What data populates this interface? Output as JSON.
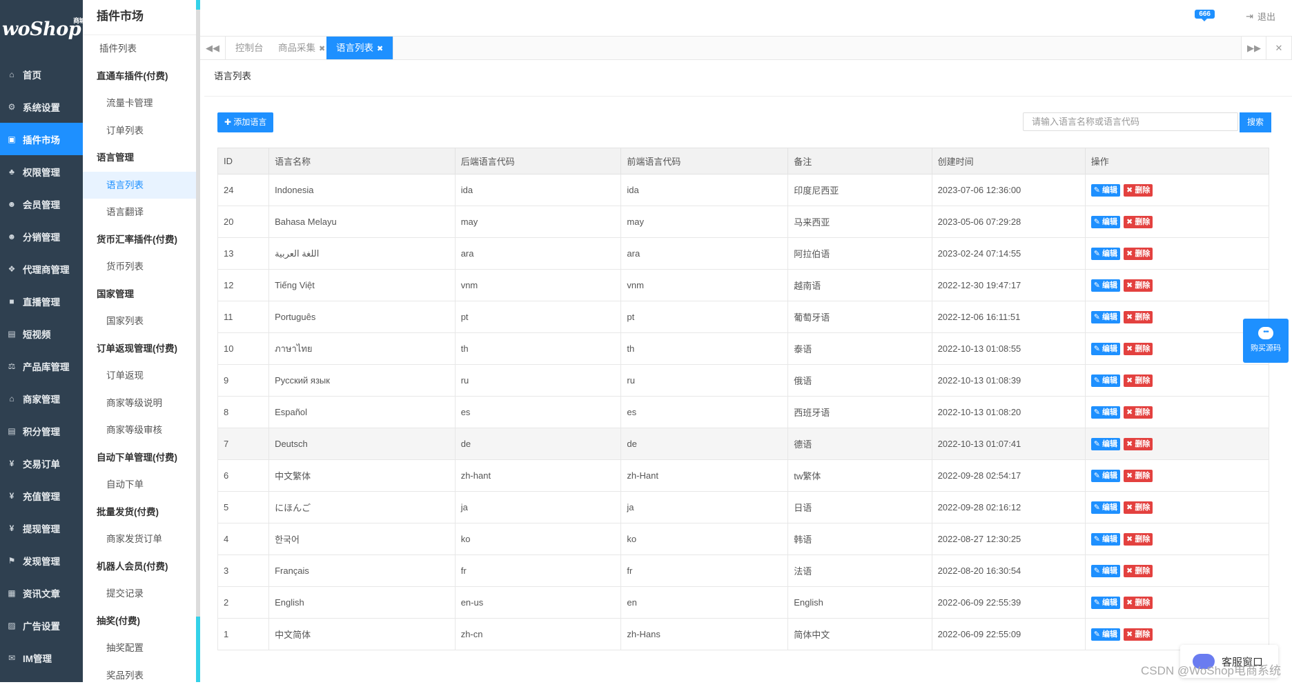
{
  "brand": {
    "logo_text": "woShop",
    "logo_sup": "商城"
  },
  "nav": [
    {
      "label": "首页",
      "icon": "home-icon",
      "glyph": "⌂"
    },
    {
      "label": "系统设置",
      "icon": "gear-icon",
      "glyph": "⚙"
    },
    {
      "label": "插件市场",
      "icon": "plugin-icon",
      "glyph": "▣",
      "active": true
    },
    {
      "label": "权限管理",
      "icon": "sitemap-icon",
      "glyph": "♣"
    },
    {
      "label": "会员管理",
      "icon": "users-icon",
      "glyph": "☻"
    },
    {
      "label": "分销管理",
      "icon": "group-icon",
      "glyph": "☻"
    },
    {
      "label": "代理商管理",
      "icon": "cubes-icon",
      "glyph": "❖"
    },
    {
      "label": "直播管理",
      "icon": "video-icon",
      "glyph": "■"
    },
    {
      "label": "短视频",
      "icon": "file-icon",
      "glyph": "▤"
    },
    {
      "label": "产品库管理",
      "icon": "balance-icon",
      "glyph": "⚖"
    },
    {
      "label": "商家管理",
      "icon": "bank-icon",
      "glyph": "⌂"
    },
    {
      "label": "积分管理",
      "icon": "document-icon",
      "glyph": "▤"
    },
    {
      "label": "交易订单",
      "icon": "yen-icon",
      "glyph": "¥"
    },
    {
      "label": "充值管理",
      "icon": "yen-icon",
      "glyph": "¥"
    },
    {
      "label": "提现管理",
      "icon": "yen-icon",
      "glyph": "¥"
    },
    {
      "label": "发现管理",
      "icon": "flag-icon",
      "glyph": "⚑"
    },
    {
      "label": "资讯文章",
      "icon": "newspaper-icon",
      "glyph": "▦"
    },
    {
      "label": "广告设置",
      "icon": "image-icon",
      "glyph": "▨"
    },
    {
      "label": "IM管理",
      "icon": "chat-icon",
      "glyph": "✉"
    }
  ],
  "subnav": {
    "title": "插件市场",
    "entries": [
      {
        "type": "item-top",
        "label": "插件列表"
      },
      {
        "type": "group",
        "label": "直通车插件(付费)"
      },
      {
        "type": "item",
        "label": "流量卡管理"
      },
      {
        "type": "item",
        "label": "订单列表"
      },
      {
        "type": "group",
        "label": "语言管理"
      },
      {
        "type": "item",
        "label": "语言列表",
        "active": true
      },
      {
        "type": "item",
        "label": "语言翻译"
      },
      {
        "type": "group",
        "label": "货币汇率插件(付费)"
      },
      {
        "type": "item",
        "label": "货币列表"
      },
      {
        "type": "group",
        "label": "国家管理"
      },
      {
        "type": "item",
        "label": "国家列表"
      },
      {
        "type": "group",
        "label": "订单返现管理(付费)"
      },
      {
        "type": "item",
        "label": "订单返现"
      },
      {
        "type": "item",
        "label": "商家等级说明"
      },
      {
        "type": "item",
        "label": "商家等级审核"
      },
      {
        "type": "group",
        "label": "自动下单管理(付费)"
      },
      {
        "type": "item",
        "label": "自动下单"
      },
      {
        "type": "group",
        "label": "批量发货(付费)"
      },
      {
        "type": "item",
        "label": "商家发货订单"
      },
      {
        "type": "group",
        "label": "机器人会员(付费)"
      },
      {
        "type": "item",
        "label": "提交记录"
      },
      {
        "type": "group",
        "label": "抽奖(付费)"
      },
      {
        "type": "item",
        "label": "抽奖配置"
      },
      {
        "type": "item",
        "label": "奖品列表"
      }
    ]
  },
  "topbar": {
    "badge": "666",
    "logout": "退出"
  },
  "tabs": [
    {
      "label": "控制台",
      "closable": false
    },
    {
      "label": "商品采集",
      "closable": true
    },
    {
      "label": "语言列表",
      "closable": true,
      "active": true
    }
  ],
  "tab_controls": {
    "prev": "◀◀",
    "next": "▶▶",
    "close": "✕"
  },
  "page": {
    "breadcrumb": "语言列表"
  },
  "toolbar": {
    "add_label": "添加语言",
    "search_placeholder": "请输入语言名称或语言代码",
    "search_label": "搜索"
  },
  "table": {
    "headers": [
      "ID",
      "语言名称",
      "后端语言代码",
      "前端语言代码",
      "备注",
      "创建时间",
      "操作"
    ],
    "actions": {
      "edit": "编辑",
      "delete": "删除"
    },
    "rows": [
      [
        "24",
        "Indonesia",
        "ida",
        "ida",
        "印度尼西亚",
        "2023-07-06 12:36:00"
      ],
      [
        "20",
        "Bahasa Melayu",
        "may",
        "may",
        "马来西亚",
        "2023-05-06 07:29:28"
      ],
      [
        "13",
        "اللغة العربية",
        "ara",
        "ara",
        "阿拉伯语",
        "2023-02-24 07:14:55"
      ],
      [
        "12",
        "Tiếng Việt",
        "vnm",
        "vnm",
        "越南语",
        "2022-12-30 19:47:17"
      ],
      [
        "11",
        "Português",
        "pt",
        "pt",
        "葡萄牙语",
        "2022-12-06 16:11:51"
      ],
      [
        "10",
        "ภาษาไทย",
        "th",
        "th",
        "泰语",
        "2022-10-13 01:08:55"
      ],
      [
        "9",
        "Русский язык",
        "ru",
        "ru",
        "俄语",
        "2022-10-13 01:08:39"
      ],
      [
        "8",
        "Español",
        "es",
        "es",
        "西班牙语",
        "2022-10-13 01:08:20"
      ],
      [
        "7",
        "Deutsch",
        "de",
        "de",
        "德语",
        "2022-10-13 01:07:41"
      ],
      [
        "6",
        "中文繁体",
        "zh-hant",
        "zh-Hant",
        "tw繁体",
        "2022-09-28 02:54:17"
      ],
      [
        "5",
        "にほんご",
        "ja",
        "ja",
        "日语",
        "2022-09-28 02:16:12"
      ],
      [
        "4",
        "한국어",
        "ko",
        "ko",
        "韩语",
        "2022-08-27 12:30:25"
      ],
      [
        "3",
        "Français",
        "fr",
        "fr",
        "法语",
        "2022-08-20 16:30:54"
      ],
      [
        "2",
        "English",
        "en-us",
        "en",
        "English",
        "2022-06-09 22:55:39"
      ],
      [
        "1",
        "中文简体",
        "zh-cn",
        "zh-Hans",
        "简体中文",
        "2022-06-09 22:55:09"
      ]
    ],
    "hover_row_index": 8
  },
  "floating": {
    "buy_source": "购买源码",
    "service": "客服窗口"
  },
  "watermark": "CSDN @WoShop电商系统",
  "colors": {
    "accent": "#1e90ff",
    "danger": "#e3413f",
    "sidebar": "#2f4050"
  }
}
